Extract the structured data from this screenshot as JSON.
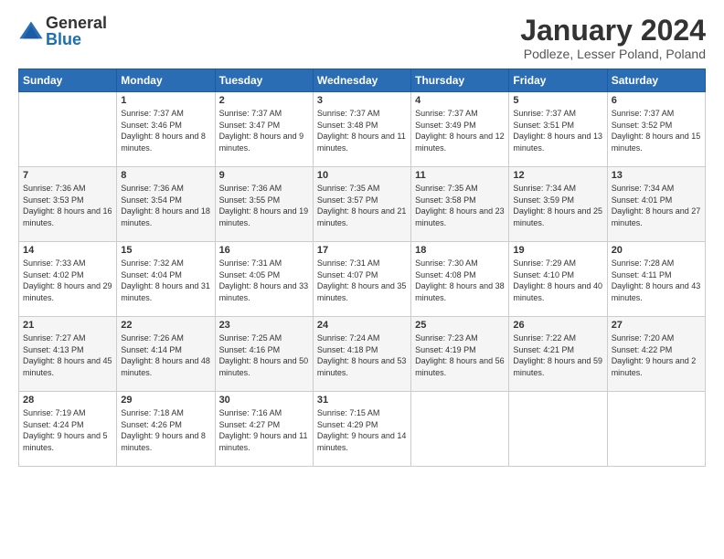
{
  "logo": {
    "general": "General",
    "blue": "Blue"
  },
  "title": "January 2024",
  "subtitle": "Podleze, Lesser Poland, Poland",
  "days_header": [
    "Sunday",
    "Monday",
    "Tuesday",
    "Wednesday",
    "Thursday",
    "Friday",
    "Saturday"
  ],
  "weeks": [
    [
      {
        "day": "",
        "sunrise": "",
        "sunset": "",
        "daylight": ""
      },
      {
        "day": "1",
        "sunrise": "Sunrise: 7:37 AM",
        "sunset": "Sunset: 3:46 PM",
        "daylight": "Daylight: 8 hours and 8 minutes."
      },
      {
        "day": "2",
        "sunrise": "Sunrise: 7:37 AM",
        "sunset": "Sunset: 3:47 PM",
        "daylight": "Daylight: 8 hours and 9 minutes."
      },
      {
        "day": "3",
        "sunrise": "Sunrise: 7:37 AM",
        "sunset": "Sunset: 3:48 PM",
        "daylight": "Daylight: 8 hours and 11 minutes."
      },
      {
        "day": "4",
        "sunrise": "Sunrise: 7:37 AM",
        "sunset": "Sunset: 3:49 PM",
        "daylight": "Daylight: 8 hours and 12 minutes."
      },
      {
        "day": "5",
        "sunrise": "Sunrise: 7:37 AM",
        "sunset": "Sunset: 3:51 PM",
        "daylight": "Daylight: 8 hours and 13 minutes."
      },
      {
        "day": "6",
        "sunrise": "Sunrise: 7:37 AM",
        "sunset": "Sunset: 3:52 PM",
        "daylight": "Daylight: 8 hours and 15 minutes."
      }
    ],
    [
      {
        "day": "7",
        "sunrise": "Sunrise: 7:36 AM",
        "sunset": "Sunset: 3:53 PM",
        "daylight": "Daylight: 8 hours and 16 minutes."
      },
      {
        "day": "8",
        "sunrise": "Sunrise: 7:36 AM",
        "sunset": "Sunset: 3:54 PM",
        "daylight": "Daylight: 8 hours and 18 minutes."
      },
      {
        "day": "9",
        "sunrise": "Sunrise: 7:36 AM",
        "sunset": "Sunset: 3:55 PM",
        "daylight": "Daylight: 8 hours and 19 minutes."
      },
      {
        "day": "10",
        "sunrise": "Sunrise: 7:35 AM",
        "sunset": "Sunset: 3:57 PM",
        "daylight": "Daylight: 8 hours and 21 minutes."
      },
      {
        "day": "11",
        "sunrise": "Sunrise: 7:35 AM",
        "sunset": "Sunset: 3:58 PM",
        "daylight": "Daylight: 8 hours and 23 minutes."
      },
      {
        "day": "12",
        "sunrise": "Sunrise: 7:34 AM",
        "sunset": "Sunset: 3:59 PM",
        "daylight": "Daylight: 8 hours and 25 minutes."
      },
      {
        "day": "13",
        "sunrise": "Sunrise: 7:34 AM",
        "sunset": "Sunset: 4:01 PM",
        "daylight": "Daylight: 8 hours and 27 minutes."
      }
    ],
    [
      {
        "day": "14",
        "sunrise": "Sunrise: 7:33 AM",
        "sunset": "Sunset: 4:02 PM",
        "daylight": "Daylight: 8 hours and 29 minutes."
      },
      {
        "day": "15",
        "sunrise": "Sunrise: 7:32 AM",
        "sunset": "Sunset: 4:04 PM",
        "daylight": "Daylight: 8 hours and 31 minutes."
      },
      {
        "day": "16",
        "sunrise": "Sunrise: 7:31 AM",
        "sunset": "Sunset: 4:05 PM",
        "daylight": "Daylight: 8 hours and 33 minutes."
      },
      {
        "day": "17",
        "sunrise": "Sunrise: 7:31 AM",
        "sunset": "Sunset: 4:07 PM",
        "daylight": "Daylight: 8 hours and 35 minutes."
      },
      {
        "day": "18",
        "sunrise": "Sunrise: 7:30 AM",
        "sunset": "Sunset: 4:08 PM",
        "daylight": "Daylight: 8 hours and 38 minutes."
      },
      {
        "day": "19",
        "sunrise": "Sunrise: 7:29 AM",
        "sunset": "Sunset: 4:10 PM",
        "daylight": "Daylight: 8 hours and 40 minutes."
      },
      {
        "day": "20",
        "sunrise": "Sunrise: 7:28 AM",
        "sunset": "Sunset: 4:11 PM",
        "daylight": "Daylight: 8 hours and 43 minutes."
      }
    ],
    [
      {
        "day": "21",
        "sunrise": "Sunrise: 7:27 AM",
        "sunset": "Sunset: 4:13 PM",
        "daylight": "Daylight: 8 hours and 45 minutes."
      },
      {
        "day": "22",
        "sunrise": "Sunrise: 7:26 AM",
        "sunset": "Sunset: 4:14 PM",
        "daylight": "Daylight: 8 hours and 48 minutes."
      },
      {
        "day": "23",
        "sunrise": "Sunrise: 7:25 AM",
        "sunset": "Sunset: 4:16 PM",
        "daylight": "Daylight: 8 hours and 50 minutes."
      },
      {
        "day": "24",
        "sunrise": "Sunrise: 7:24 AM",
        "sunset": "Sunset: 4:18 PM",
        "daylight": "Daylight: 8 hours and 53 minutes."
      },
      {
        "day": "25",
        "sunrise": "Sunrise: 7:23 AM",
        "sunset": "Sunset: 4:19 PM",
        "daylight": "Daylight: 8 hours and 56 minutes."
      },
      {
        "day": "26",
        "sunrise": "Sunrise: 7:22 AM",
        "sunset": "Sunset: 4:21 PM",
        "daylight": "Daylight: 8 hours and 59 minutes."
      },
      {
        "day": "27",
        "sunrise": "Sunrise: 7:20 AM",
        "sunset": "Sunset: 4:22 PM",
        "daylight": "Daylight: 9 hours and 2 minutes."
      }
    ],
    [
      {
        "day": "28",
        "sunrise": "Sunrise: 7:19 AM",
        "sunset": "Sunset: 4:24 PM",
        "daylight": "Daylight: 9 hours and 5 minutes."
      },
      {
        "day": "29",
        "sunrise": "Sunrise: 7:18 AM",
        "sunset": "Sunset: 4:26 PM",
        "daylight": "Daylight: 9 hours and 8 minutes."
      },
      {
        "day": "30",
        "sunrise": "Sunrise: 7:16 AM",
        "sunset": "Sunset: 4:27 PM",
        "daylight": "Daylight: 9 hours and 11 minutes."
      },
      {
        "day": "31",
        "sunrise": "Sunrise: 7:15 AM",
        "sunset": "Sunset: 4:29 PM",
        "daylight": "Daylight: 9 hours and 14 minutes."
      },
      {
        "day": "",
        "sunrise": "",
        "sunset": "",
        "daylight": ""
      },
      {
        "day": "",
        "sunrise": "",
        "sunset": "",
        "daylight": ""
      },
      {
        "day": "",
        "sunrise": "",
        "sunset": "",
        "daylight": ""
      }
    ]
  ]
}
